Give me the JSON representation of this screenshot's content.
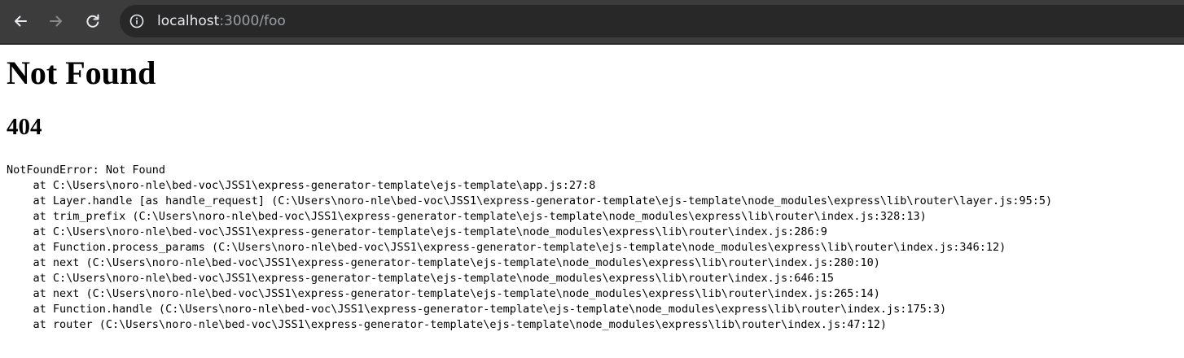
{
  "browser": {
    "url_host": "localhost",
    "url_path": ":3000/foo",
    "icons": {
      "back": "arrow-left-icon",
      "forward": "arrow-right-icon",
      "reload": "reload-icon",
      "site_info": "info-circle-icon"
    }
  },
  "page": {
    "title": "Not Found",
    "status": "404",
    "stack_header": "NotFoundError: Not Found",
    "stack_lines": [
      "    at C:\\Users\\noro-nle\\bed-voc\\JSS1\\express-generator-template\\ejs-template\\app.js:27:8",
      "    at Layer.handle [as handle_request] (C:\\Users\\noro-nle\\bed-voc\\JSS1\\express-generator-template\\ejs-template\\node_modules\\express\\lib\\router\\layer.js:95:5)",
      "    at trim_prefix (C:\\Users\\noro-nle\\bed-voc\\JSS1\\express-generator-template\\ejs-template\\node_modules\\express\\lib\\router\\index.js:328:13)",
      "    at C:\\Users\\noro-nle\\bed-voc\\JSS1\\express-generator-template\\ejs-template\\node_modules\\express\\lib\\router\\index.js:286:9",
      "    at Function.process_params (C:\\Users\\noro-nle\\bed-voc\\JSS1\\express-generator-template\\ejs-template\\node_modules\\express\\lib\\router\\index.js:346:12)",
      "    at next (C:\\Users\\noro-nle\\bed-voc\\JSS1\\express-generator-template\\ejs-template\\node_modules\\express\\lib\\router\\index.js:280:10)",
      "    at C:\\Users\\noro-nle\\bed-voc\\JSS1\\express-generator-template\\ejs-template\\node_modules\\express\\lib\\router\\index.js:646:15",
      "    at next (C:\\Users\\noro-nle\\bed-voc\\JSS1\\express-generator-template\\ejs-template\\node_modules\\express\\lib\\router\\index.js:265:14)",
      "    at Function.handle (C:\\Users\\noro-nle\\bed-voc\\JSS1\\express-generator-template\\ejs-template\\node_modules\\express\\lib\\router\\index.js:175:3)",
      "    at router (C:\\Users\\noro-nle\\bed-voc\\JSS1\\express-generator-template\\ejs-template\\node_modules\\express\\lib\\router\\index.js:47:12)"
    ]
  },
  "colors": {
    "toolbar_bg": "#3c3c3c",
    "omnibox_bg": "#282828",
    "url_host": "#e8eaed",
    "url_path": "#9aa0a6"
  }
}
